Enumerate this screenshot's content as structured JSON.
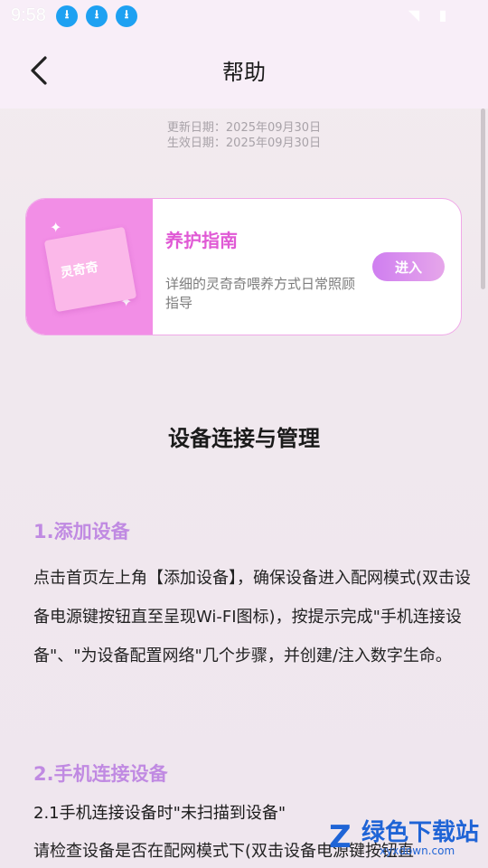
{
  "status_bar": {
    "time": "9:58",
    "download_icons": [
      "download-icon",
      "download-icon",
      "download-icon"
    ]
  },
  "header": {
    "title": "帮助",
    "back_icon": "chevron-left-icon"
  },
  "dates": {
    "updated": "更新日期：2025年09月30日",
    "effective": "生效日期：2025年09月30日"
  },
  "card": {
    "title": "养护指南",
    "description": "详细的灵奇奇喂养方式日常照顾指导",
    "button_label": "进入",
    "image_text": "灵奇奇"
  },
  "content": {
    "section_title": "设备连接与管理",
    "h1": "1.添加设备",
    "p1": "点击首页左上角【添加设备】，确保设备进入配网模式(双击设备电源键按钮直至呈现Wi-FI图标)，按提示完成\"手机连接设备\"、\"为设备配置网络\"几个步骤，并创建/注入数字生命。",
    "h2": "2.手机连接设备",
    "sub21": "2.1手机连接设备时\"未扫描到设备\"",
    "p2": "请检查设备是否在配网模式下(双击设备电源键按钮直"
  },
  "watermark": {
    "text": "绿色下载站",
    "url": "xyxdown.com"
  },
  "colors": {
    "accent": "#e05ad5",
    "heading": "#c08ae2",
    "card_border": "#f0a8e8",
    "download_badge": "#1ea1f2"
  }
}
